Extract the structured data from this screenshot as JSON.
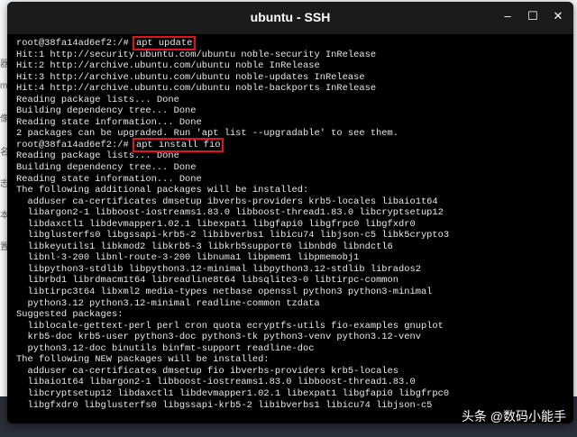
{
  "background_chars": [
    "器",
    "m",
    "像",
    "名",
    "志",
    "本",
    "置"
  ],
  "window": {
    "title": "ubuntu - SSH",
    "minimize": "–",
    "maximize": "☐",
    "close": "✕"
  },
  "terminal": {
    "prompt1": "root@38fa14ad6ef2:/# ",
    "cmd1": "apt update",
    "block1": [
      "Hit:1 http://security.ubuntu.com/ubuntu noble-security InRelease",
      "Hit:2 http://archive.ubuntu.com/ubuntu noble InRelease",
      "Hit:3 http://archive.ubuntu.com/ubuntu noble-updates InRelease",
      "Hit:4 http://archive.ubuntu.com/ubuntu noble-backports InRelease",
      "Reading package lists... Done",
      "Building dependency tree... Done",
      "Reading state information... Done",
      "2 packages can be upgraded. Run 'apt list --upgradable' to see them."
    ],
    "prompt2": "root@38fa14ad6ef2:/# ",
    "cmd2": "apt install fio",
    "block2": [
      "Reading package lists... Done",
      "Building dependency tree... Done",
      "Reading state information... Done",
      "The following additional packages will be installed:",
      "  adduser ca-certificates dmsetup ibverbs-providers krb5-locales libaio1t64",
      "  libargon2-1 libboost-iostreams1.83.0 libboost-thread1.83.0 libcryptsetup12",
      "  libdaxctl1 libdevmapper1.02.1 libexpat1 libgfapi0 libgfrpc0 libgfxdr0",
      "  libglusterfs0 libgssapi-krb5-2 libibverbs1 libicu74 libjson-c5 libk5crypto3",
      "  libkeyutils1 libkmod2 libkrb5-3 libkrb5support0 libnbd0 libndctl6",
      "  libnl-3-200 libnl-route-3-200 libnuma1 libpmem1 libpmemobj1",
      "  libpython3-stdlib libpython3.12-minimal libpython3.12-stdlib librados2",
      "  librbd1 librdmacm1t64 libreadline8t64 libsqlite3-0 libtirpc-common",
      "  libtirpc3t64 libxml2 media-types netbase openssl python3 python3-minimal",
      "  python3.12 python3.12-minimal readline-common tzdata",
      "Suggested packages:",
      "  liblocale-gettext-perl perl cron quota ecryptfs-utils fio-examples gnuplot",
      "  krb5-doc krb5-user python3-doc python3-tk python3-venv python3.12-venv",
      "  python3.12-doc binutils binfmt-support readline-doc",
      "The following NEW packages will be installed:",
      "  adduser ca-certificates dmsetup fio ibverbs-providers krb5-locales",
      "  libaio1t64 libargon2-1 libboost-iostreams1.83.0 libboost-thread1.83.0",
      "  libcryptsetup12 libdaxctl1 libdevmapper1.02.1 libexpat1 libgfapi0 libgfrpc0",
      "  libgfxdr0 libglusterfs0 libgssapi-krb5-2 libibverbs1 libicu74 libjson-c5"
    ]
  },
  "watermark": "头条 @数码小能手"
}
